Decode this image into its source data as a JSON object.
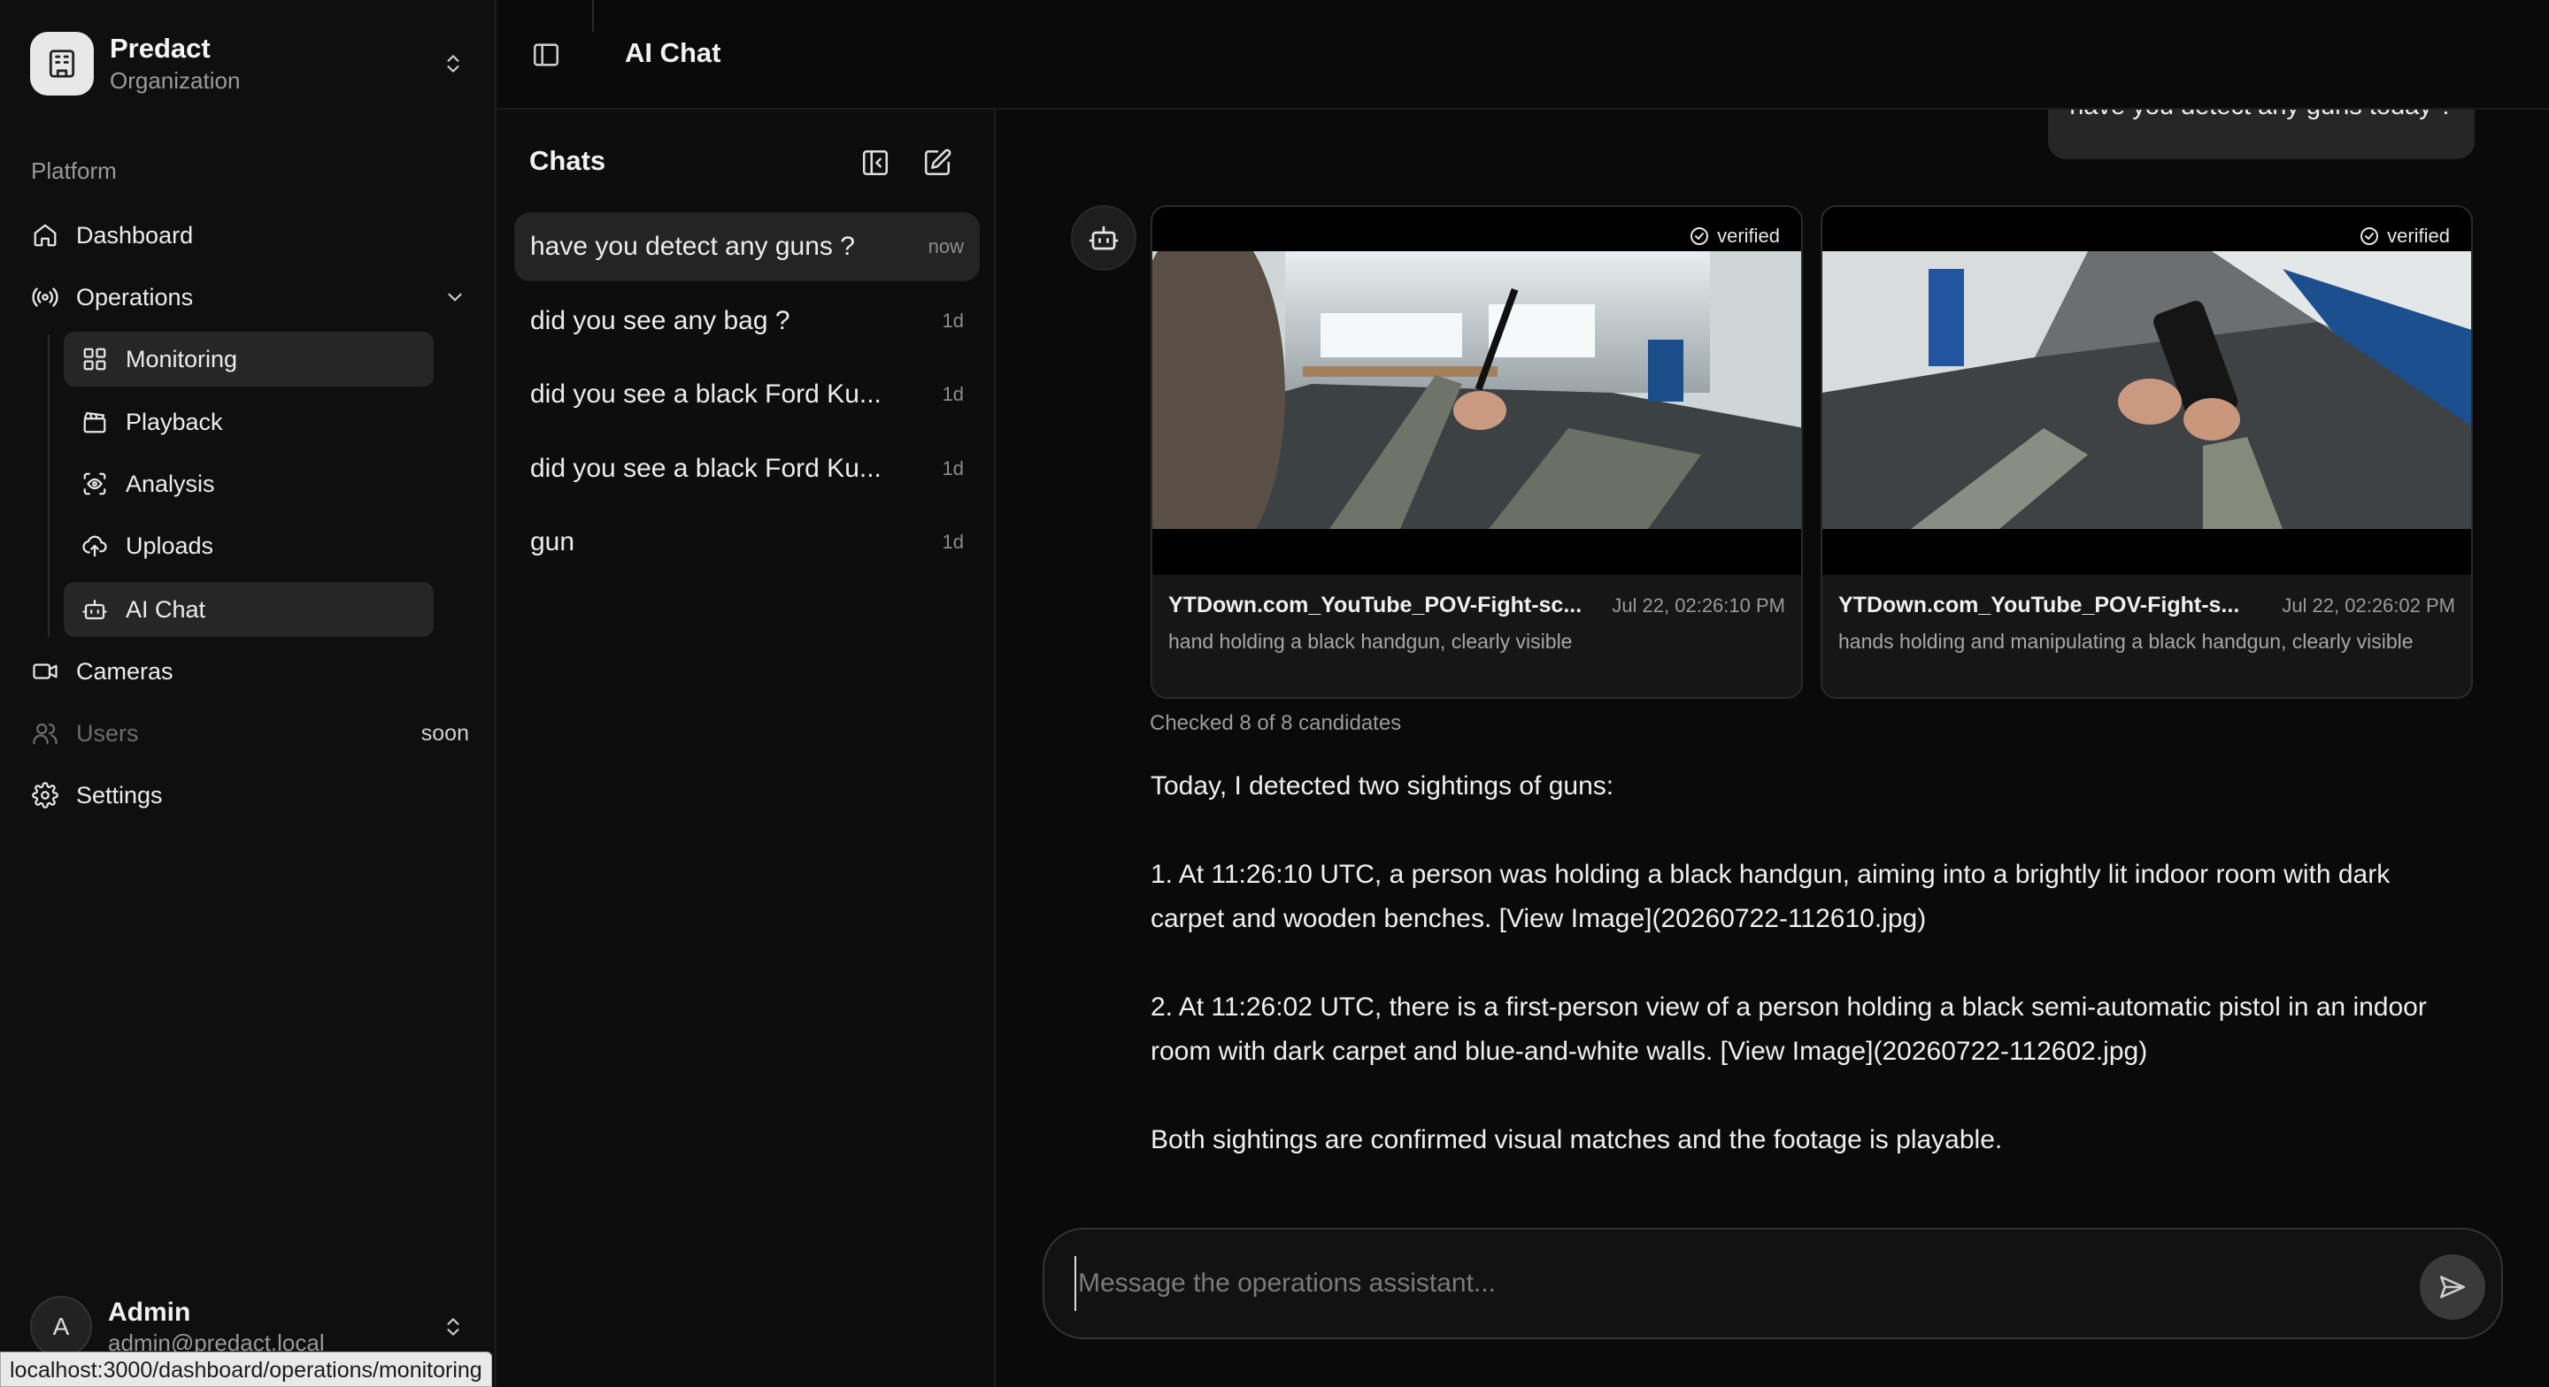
{
  "org": {
    "name": "Predact",
    "subtitle": "Organization",
    "logo_icon": "building-icon"
  },
  "sidebar": {
    "section_label": "Platform",
    "items": [
      {
        "label": "Dashboard",
        "icon": "home-icon"
      },
      {
        "label": "Operations",
        "icon": "radio-broadcast-icon",
        "expanded": true
      },
      {
        "label": "Monitoring",
        "icon": "grid-icon",
        "active": true
      },
      {
        "label": "Playback",
        "icon": "clapperboard-icon"
      },
      {
        "label": "Analysis",
        "icon": "scan-eye-icon"
      },
      {
        "label": "Uploads",
        "icon": "cloud-upload-icon"
      },
      {
        "label": "AI Chat",
        "icon": "bot-icon",
        "active": true
      },
      {
        "label": "Cameras",
        "icon": "video-camera-icon"
      },
      {
        "label": "Users",
        "icon": "users-icon",
        "disabled": true,
        "badge": "soon"
      },
      {
        "label": "Settings",
        "icon": "gear-icon"
      }
    ]
  },
  "user": {
    "initial": "A",
    "name": "Admin",
    "email": "admin@predact.local"
  },
  "status_url": "localhost:3000/dashboard/operations/monitoring",
  "header": {
    "title": "AI Chat"
  },
  "chats": {
    "title": "Chats",
    "items": [
      {
        "title": "have you detect any guns ?",
        "meta": "now",
        "active": true
      },
      {
        "title": "did you see any bag ?",
        "meta": "1d"
      },
      {
        "title": "did you see a black Ford Ku...",
        "meta": "1d"
      },
      {
        "title": "did you see a black Ford Ku...",
        "meta": "1d"
      },
      {
        "title": "gun",
        "meta": "1d"
      }
    ]
  },
  "conversation": {
    "user_message": "have you detect any guns today ?",
    "cards": [
      {
        "badge": "verified",
        "file": "YTDown.com_YouTube_POV-Fight-sc...",
        "time": "Jul 22, 02:26:10 PM",
        "description": "hand holding a black handgun, clearly visible"
      },
      {
        "badge": "verified",
        "file": "YTDown.com_YouTube_POV-Fight-s...",
        "time": "Jul 22, 02:26:02 PM",
        "description": "hands holding and manipulating a black handgun, clearly visible"
      }
    ],
    "checked": "Checked 8 of 8 candidates",
    "answer": [
      "Today, I detected two sightings of guns:",
      "1. At 11:26:10 UTC, a person was holding a black handgun, aiming into a brightly lit indoor room with dark carpet and wooden benches. [View Image](20260722-112610.jpg)",
      "2. At 11:26:02 UTC, there is a first-person view of a person holding a black semi-automatic pistol in an indoor room with dark carpet and blue-and-white walls. [View Image](20260722-112602.jpg)",
      "Both sightings are confirmed visual matches and the footage is playable."
    ]
  },
  "composer": {
    "placeholder": "Message the operations assistant..."
  },
  "colors": {
    "background": "#0a0a0a",
    "sidebar": "#0f0f0f",
    "active_item": "#262626",
    "bubble": "#262626"
  }
}
